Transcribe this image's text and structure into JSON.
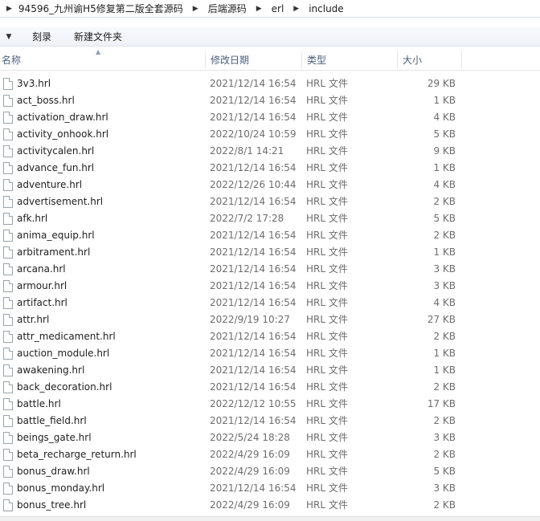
{
  "address": {
    "crumbs": [
      "94596_九州谕H5修复第二版全套源码",
      "后端源码",
      "erl",
      "include"
    ]
  },
  "toolbar": {
    "burn_label": "刻录",
    "new_folder_label": "新建文件夹"
  },
  "columns": {
    "name": "名称",
    "date": "修改日期",
    "type": "类型",
    "size": "大小"
  },
  "files": [
    {
      "name": "3v3.hrl",
      "date": "2021/12/14 16:54",
      "type": "HRL 文件",
      "size": "29 KB"
    },
    {
      "name": "act_boss.hrl",
      "date": "2021/12/14 16:54",
      "type": "HRL 文件",
      "size": "1 KB"
    },
    {
      "name": "activation_draw.hrl",
      "date": "2021/12/14 16:54",
      "type": "HRL 文件",
      "size": "4 KB"
    },
    {
      "name": "activity_onhook.hrl",
      "date": "2022/10/24 10:59",
      "type": "HRL 文件",
      "size": "5 KB"
    },
    {
      "name": "activitycalen.hrl",
      "date": "2022/8/1 14:21",
      "type": "HRL 文件",
      "size": "9 KB"
    },
    {
      "name": "advance_fun.hrl",
      "date": "2021/12/14 16:54",
      "type": "HRL 文件",
      "size": "1 KB"
    },
    {
      "name": "adventure.hrl",
      "date": "2022/12/26 10:44",
      "type": "HRL 文件",
      "size": "4 KB"
    },
    {
      "name": "advertisement.hrl",
      "date": "2021/12/14 16:54",
      "type": "HRL 文件",
      "size": "2 KB"
    },
    {
      "name": "afk.hrl",
      "date": "2022/7/2 17:28",
      "type": "HRL 文件",
      "size": "5 KB"
    },
    {
      "name": "anima_equip.hrl",
      "date": "2021/12/14 16:54",
      "type": "HRL 文件",
      "size": "2 KB"
    },
    {
      "name": "arbitrament.hrl",
      "date": "2021/12/14 16:54",
      "type": "HRL 文件",
      "size": "1 KB"
    },
    {
      "name": "arcana.hrl",
      "date": "2021/12/14 16:54",
      "type": "HRL 文件",
      "size": "3 KB"
    },
    {
      "name": "armour.hrl",
      "date": "2021/12/14 16:54",
      "type": "HRL 文件",
      "size": "3 KB"
    },
    {
      "name": "artifact.hrl",
      "date": "2021/12/14 16:54",
      "type": "HRL 文件",
      "size": "4 KB"
    },
    {
      "name": "attr.hrl",
      "date": "2022/9/19 10:27",
      "type": "HRL 文件",
      "size": "27 KB"
    },
    {
      "name": "attr_medicament.hrl",
      "date": "2021/12/14 16:54",
      "type": "HRL 文件",
      "size": "2 KB"
    },
    {
      "name": "auction_module.hrl",
      "date": "2021/12/14 16:54",
      "type": "HRL 文件",
      "size": "1 KB"
    },
    {
      "name": "awakening.hrl",
      "date": "2021/12/14 16:54",
      "type": "HRL 文件",
      "size": "1 KB"
    },
    {
      "name": "back_decoration.hrl",
      "date": "2021/12/14 16:54",
      "type": "HRL 文件",
      "size": "2 KB"
    },
    {
      "name": "battle.hrl",
      "date": "2022/12/12 10:55",
      "type": "HRL 文件",
      "size": "17 KB"
    },
    {
      "name": "battle_field.hrl",
      "date": "2021/12/14 16:54",
      "type": "HRL 文件",
      "size": "2 KB"
    },
    {
      "name": "beings_gate.hrl",
      "date": "2022/5/24 18:28",
      "type": "HRL 文件",
      "size": "3 KB"
    },
    {
      "name": "beta_recharge_return.hrl",
      "date": "2022/4/29 16:09",
      "type": "HRL 文件",
      "size": "2 KB"
    },
    {
      "name": "bonus_draw.hrl",
      "date": "2022/4/29 16:09",
      "type": "HRL 文件",
      "size": "5 KB"
    },
    {
      "name": "bonus_monday.hrl",
      "date": "2021/12/14 16:54",
      "type": "HRL 文件",
      "size": "3 KB"
    },
    {
      "name": "bonus_tree.hrl",
      "date": "2022/4/29 16:09",
      "type": "HRL 文件",
      "size": "2 KB"
    }
  ]
}
